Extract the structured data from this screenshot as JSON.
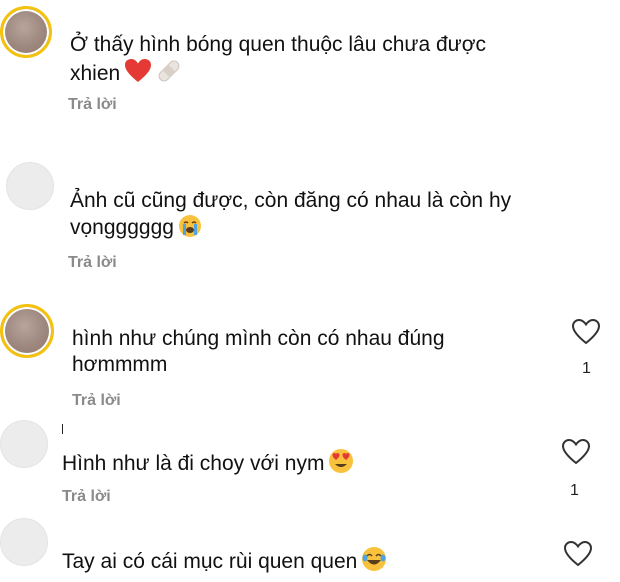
{
  "reply_label": "Trả lời",
  "comments": [
    {
      "text": "Ở thấy hình bóng quen thuộc lâu chưa được xhien",
      "emojis": [
        "red-heart",
        "bandage"
      ],
      "likes": ""
    },
    {
      "text": "Ảnh cũ cũng được, còn đăng có nhau là còn hy vọngggggg",
      "emojis": [
        "loudly-crying-face"
      ],
      "likes": ""
    },
    {
      "text": "hình như chúng mình còn có nhau đúng hơmmmm",
      "emojis": [],
      "likes": "1"
    },
    {
      "text": "Hình như là đi choy với nym",
      "emojis": [
        "heart-eyes-face"
      ],
      "likes": "1"
    },
    {
      "text": "Tay ai có cái mục rùi quen quen",
      "emojis": [
        "tears-of-joy-face"
      ],
      "likes": ""
    }
  ],
  "colors": {
    "story_ring": "#f4c20d",
    "reply_text": "#8a8a8a",
    "heart_outline": "#333333",
    "emoji_red": "#e53935",
    "emoji_yellow": "#f9c23c"
  }
}
